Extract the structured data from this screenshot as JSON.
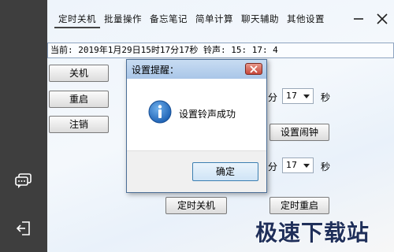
{
  "tabs": [
    "定时关机",
    "批量操作",
    "备忘笔记",
    "简单计算",
    "聊天辅助",
    "其他设置"
  ],
  "status": {
    "text": "当前: 2019年1月29日15时17分17秒 铃声: 15: 17: 4"
  },
  "left_buttons": {
    "shutdown": "关机",
    "restart": "重启",
    "logoff": "注销"
  },
  "row1": {
    "minute_suffix": "分",
    "seconds_value": "17",
    "seconds_label": "秒"
  },
  "set_alarm_button": "设置闹钟",
  "row2": {
    "minute_suffix": "分",
    "seconds_value": "17",
    "seconds_label": "秒"
  },
  "bottom_buttons": {
    "timed_shutdown": "定时关机",
    "timed_restart": "定时重启"
  },
  "dialog": {
    "title": "设置提醒：",
    "message": "设置铃声成功",
    "ok_label": "确定"
  },
  "watermark": "极速下载站",
  "colors": {
    "rail": "#3e3e3e",
    "dialog_title": "#b8d1ee",
    "close_button": "#c7473a",
    "accent": "#1f63b5"
  },
  "icons": [
    "chat-icon",
    "exit-icon",
    "minimize-icon",
    "close-icon",
    "info-icon"
  ]
}
